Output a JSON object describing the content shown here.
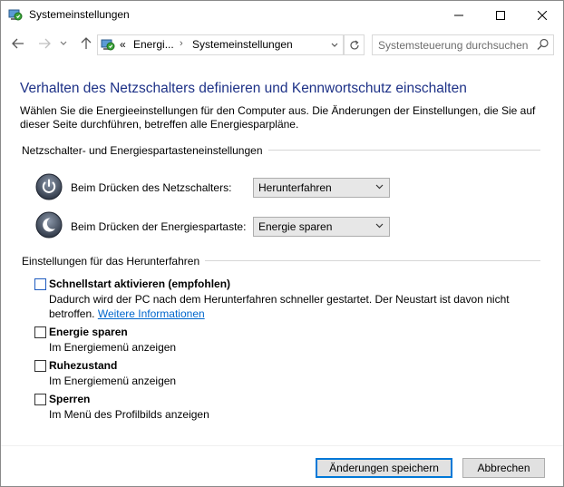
{
  "window": {
    "title": "Systemeinstellungen"
  },
  "nav": {
    "breadcrumb_overflow": "«",
    "crumbs": [
      "Energi...",
      "Systemeinstellungen"
    ],
    "search_placeholder": "Systemsteuerung durchsuchen"
  },
  "main": {
    "heading": "Verhalten des Netzschalters definieren und Kennwortschutz einschalten",
    "description": "Wählen Sie die Energieeinstellungen für den Computer aus. Die Änderungen der Einstellungen, die Sie auf dieser Seite durchführen, betreffen alle Energiesparpläne.",
    "power_group_title": "Netzschalter- und Energiespartasteneinstellungen",
    "power_button": {
      "label": "Beim Drücken des Netzschalters:",
      "value": "Herunterfahren"
    },
    "sleep_button": {
      "label": "Beim Drücken der Energiespartaste:",
      "value": "Energie sparen"
    },
    "shutdown_group_title": "Einstellungen für das Herunterfahren",
    "options": [
      {
        "label": "Schnellstart aktivieren (empfohlen)",
        "description": "Dadurch wird der PC nach dem Herunterfahren schneller gestartet. Der Neustart ist davon nicht betroffen.",
        "link": "Weitere Informationen",
        "checked": false
      },
      {
        "label": "Energie sparen",
        "description": "Im Energiemenü anzeigen",
        "checked": false
      },
      {
        "label": "Ruhezustand",
        "description": "Im Energiemenü anzeigen",
        "checked": false
      },
      {
        "label": "Sperren",
        "description": "Im Menü des Profilbilds anzeigen",
        "checked": false
      }
    ]
  },
  "footer": {
    "save_label": "Änderungen speichern",
    "cancel_label": "Abbrechen"
  },
  "colors": {
    "heading": "#1e3287",
    "link": "#0066cc",
    "accent": "#0078d7"
  }
}
